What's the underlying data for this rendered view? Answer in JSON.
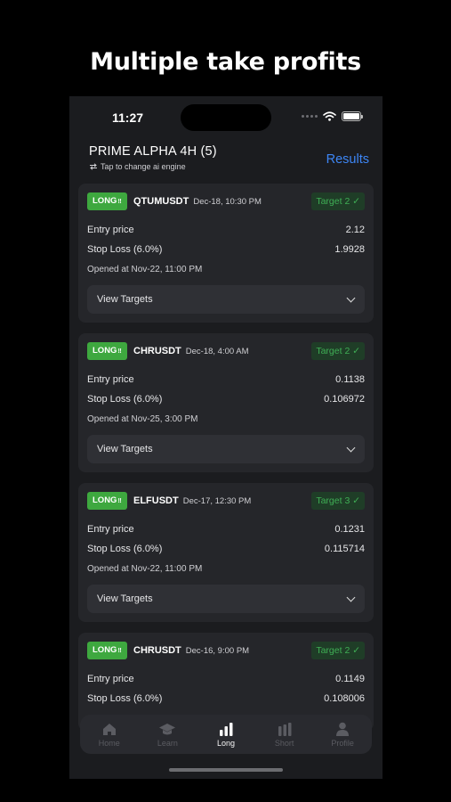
{
  "headline": "Multiple take profits",
  "status_bar": {
    "time": "11:27"
  },
  "header": {
    "engine_title": "PRIME ALPHA 4H (5)",
    "engine_subtitle": "Tap to change ai engine",
    "results_label": "Results"
  },
  "colors": {
    "accent": "#3d86f5",
    "long_badge": "#3ea83f",
    "target_text": "#3fae55",
    "background": "#1b1c1f",
    "card": "#25262a"
  },
  "signals": [
    {
      "badge": "LONG",
      "pair": "QTUMUSDT",
      "date": "Dec-18, 10:30 PM",
      "target": "Target 2 ✓",
      "entry_label": "Entry price",
      "entry_value": "2.12",
      "sl_label": "Stop Loss (6.0%)",
      "sl_value": "1.9928",
      "opened": "Opened at Nov-22, 11:00 PM",
      "view_targets": "View Targets"
    },
    {
      "badge": "LONG",
      "pair": "CHRUSDT",
      "date": "Dec-18, 4:00 AM",
      "target": "Target 2 ✓",
      "entry_label": "Entry price",
      "entry_value": "0.1138",
      "sl_label": "Stop Loss (6.0%)",
      "sl_value": "0.106972",
      "opened": "Opened at Nov-25, 3:00 PM",
      "view_targets": "View Targets"
    },
    {
      "badge": "LONG",
      "pair": "ELFUSDT",
      "date": "Dec-17, 12:30 PM",
      "target": "Target 3 ✓",
      "entry_label": "Entry price",
      "entry_value": "0.1231",
      "sl_label": "Stop Loss (6.0%)",
      "sl_value": "0.115714",
      "opened": "Opened at Nov-22, 11:00 PM",
      "view_targets": "View Targets"
    },
    {
      "badge": "LONG",
      "pair": "CHRUSDT",
      "date": "Dec-16, 9:00 PM",
      "target": "Target 2 ✓",
      "entry_label": "Entry price",
      "entry_value": "0.1149",
      "sl_label": "Stop Loss (6.0%)",
      "sl_value": "0.108006"
    }
  ],
  "tabs": [
    {
      "label": "Home",
      "icon": "home-icon"
    },
    {
      "label": "Learn",
      "icon": "graduation-cap-icon"
    },
    {
      "label": "Long",
      "icon": "bars-up-icon",
      "active": true
    },
    {
      "label": "Short",
      "icon": "bars-down-icon"
    },
    {
      "label": "Profile",
      "icon": "user-icon"
    }
  ]
}
